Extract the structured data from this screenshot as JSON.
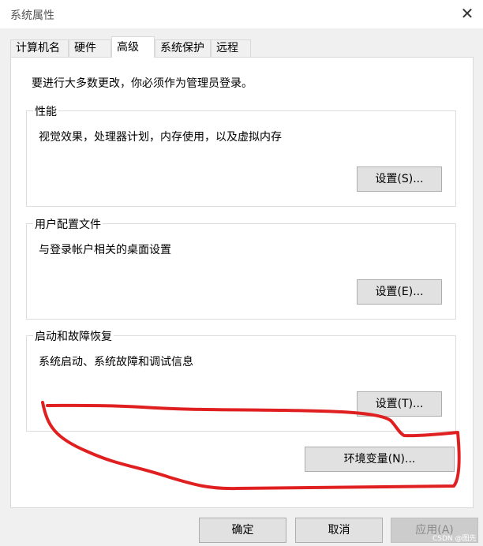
{
  "window": {
    "title": "系统属性",
    "close_label": "✕"
  },
  "tabs": [
    "计算机名",
    "硬件",
    "高级",
    "系统保护",
    "远程"
  ],
  "active_tab": "高级",
  "notice": "要进行大多数更改，你必须作为管理员登录。",
  "groups": [
    {
      "label": "性能",
      "description": "视觉效果，处理器计划，内存使用，以及虚拟内存",
      "button": "设置(S)..."
    },
    {
      "label": "用户配置文件",
      "description": "与登录帐户相关的桌面设置",
      "button": "设置(E)..."
    },
    {
      "label": "启动和故障恢复",
      "description": "系统启动、系统故障和调试信息",
      "button": "设置(T)..."
    }
  ],
  "env_button": "环境变量(N)...",
  "footer": {
    "ok": "确定",
    "cancel": "取消",
    "apply": "应用(A)"
  },
  "annotation": {
    "color": "#e02020",
    "shape": "hand-drawn loop circling 环境变量 button"
  },
  "watermark": "CSDN @图先"
}
